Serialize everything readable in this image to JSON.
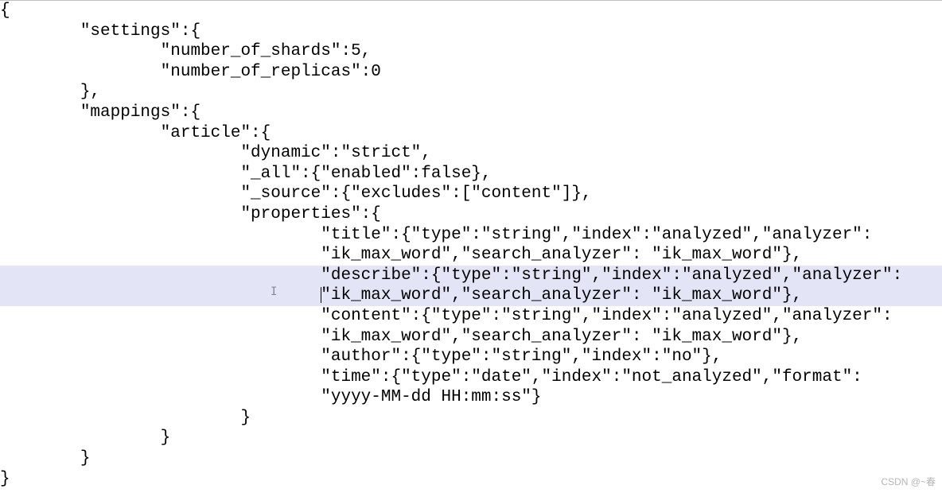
{
  "watermark": "CSDN @~春",
  "bookmark_glyph": "I",
  "lines": [
    {
      "text": "{",
      "hl": false
    },
    {
      "text": "        \"settings\":{",
      "hl": false
    },
    {
      "text": "                \"number_of_shards\":5,",
      "hl": false
    },
    {
      "text": "                \"number_of_replicas\":0",
      "hl": false
    },
    {
      "text": "        },",
      "hl": false
    },
    {
      "text": "        \"mappings\":{",
      "hl": false
    },
    {
      "text": "                \"article\":{",
      "hl": false
    },
    {
      "text": "                        \"dynamic\":\"strict\",",
      "hl": false
    },
    {
      "text": "                        \"_all\":{\"enabled\":false},",
      "hl": false
    },
    {
      "text": "                        \"_source\":{\"excludes\":[\"content\"]},",
      "hl": false
    },
    {
      "text": "                        \"properties\":{",
      "hl": false
    },
    {
      "text": "                                \"title\":{\"type\":\"string\",\"index\":\"analyzed\",\"analyzer\":",
      "hl": false
    },
    {
      "text": "                                \"ik_max_word\",\"search_analyzer\": \"ik_max_word\"},",
      "hl": false
    },
    {
      "text": "                                \"describe\":{\"type\":\"string\",\"index\":\"analyzed\",\"analyzer\":",
      "hl": true
    },
    {
      "text": "                                \"ik_max_word\",\"search_analyzer\": \"ik_max_word\"},",
      "hl": true,
      "caret": true
    },
    {
      "text": "                                \"content\":{\"type\":\"string\",\"index\":\"analyzed\",\"analyzer\":",
      "hl": false
    },
    {
      "text": "                                \"ik_max_word\",\"search_analyzer\": \"ik_max_word\"},",
      "hl": false
    },
    {
      "text": "                                \"author\":{\"type\":\"string\",\"index\":\"no\"},",
      "hl": false
    },
    {
      "text": "                                \"time\":{\"type\":\"date\",\"index\":\"not_analyzed\",\"format\":",
      "hl": false
    },
    {
      "text": "                                \"yyyy-MM-dd HH:mm:ss\"}",
      "hl": false
    },
    {
      "text": "                        }",
      "hl": false
    },
    {
      "text": "                }",
      "hl": false
    },
    {
      "text": "        }",
      "hl": false
    },
    {
      "text": "}",
      "hl": false
    }
  ]
}
